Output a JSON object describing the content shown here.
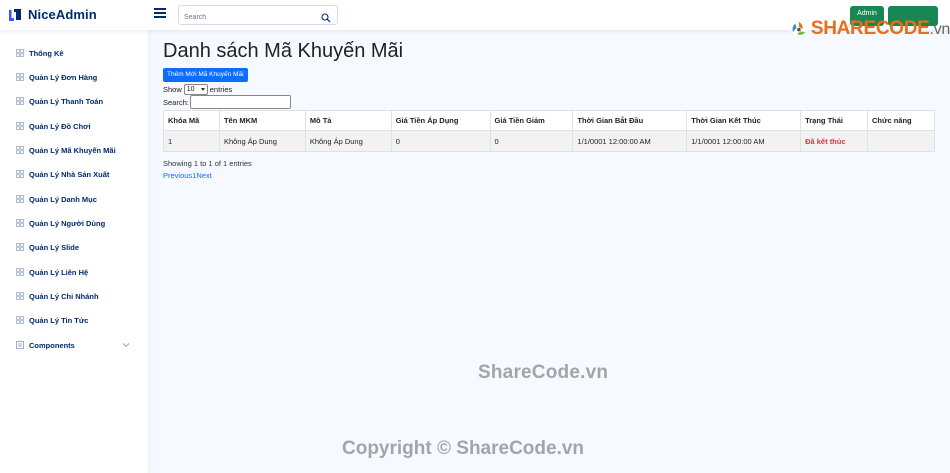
{
  "header": {
    "brand": "NiceAdmin",
    "search_placeholder": "Search",
    "admin_label": "Admin"
  },
  "watermark": {
    "logo_main": "SHARECODE",
    "logo_suffix": ".vn",
    "center_text": "ShareCode.vn",
    "copyright": "Copyright © ShareCode.vn"
  },
  "sidebar": {
    "items": [
      {
        "label": "Thống Kê"
      },
      {
        "label": "Quản Lý Đơn Hàng"
      },
      {
        "label": "Quản Lý Thanh Toán"
      },
      {
        "label": "Quản Lý Đồ Chơi"
      },
      {
        "label": "Quản Lý Mã Khuyến Mãi"
      },
      {
        "label": "Quản Lý Nhà Sản Xuất"
      },
      {
        "label": "Quản Lý Danh Mục"
      },
      {
        "label": "Quản Lý Người Dùng"
      },
      {
        "label": "Quản Lý Slide"
      },
      {
        "label": "Quản Lý Liên Hệ"
      },
      {
        "label": "Quản Lý Chi Nhánh"
      },
      {
        "label": "Quản Lý Tin Tức"
      },
      {
        "label": "Components"
      }
    ]
  },
  "main": {
    "title": "Danh sách Mã Khuyến Mãi",
    "add_button": "Thêm Mới Mã Khuyến Mãi",
    "show_label": "Show",
    "show_value": "10",
    "entries_label": "entries",
    "search_label": "Search:",
    "columns": [
      "Khóa Mã",
      "Tên MKM",
      "Mô Tả",
      "Giá Tiền Áp Dụng",
      "Giá Tiền Giảm",
      "Thời Gian Bắt Đầu",
      "Thời Gian Kết Thúc",
      "Trạng Thái",
      "Chức năng"
    ],
    "rows": [
      [
        "1",
        "Không Áp Dung",
        "Không Áp Dung",
        "0",
        "0",
        "1/1/0001 12:00:00 AM",
        "1/1/0001 12:00:00 AM",
        "Đã kết thúc",
        ""
      ]
    ],
    "info": "Showing 1 to 1 of 1 entries",
    "pager": {
      "previous": "Previous",
      "page": "1",
      "next": "Next"
    }
  },
  "colors": {
    "brand": "#012970",
    "primary": "#0d6efd",
    "success": "#198754",
    "danger": "#dc3545",
    "background": "#f6f9ff"
  }
}
